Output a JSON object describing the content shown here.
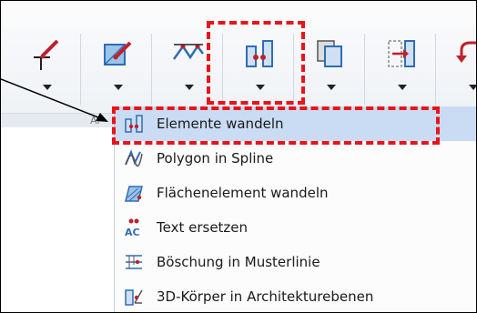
{
  "ribbon": {
    "group_label": "Är",
    "tools": [
      {
        "name": "line-pencil-tool",
        "icon": "pencil-line-icon"
      },
      {
        "name": "edit-surface-tool",
        "icon": "edit-surface-icon"
      },
      {
        "name": "polyline-tool",
        "icon": "polyline-icon"
      },
      {
        "name": "convert-elements-tool",
        "icon": "convert-elements-icon"
      },
      {
        "name": "copy-tool",
        "icon": "copy-icon"
      },
      {
        "name": "move-into-tool",
        "icon": "move-into-icon"
      },
      {
        "name": "undo-tool",
        "icon": "undo-icon"
      }
    ]
  },
  "menu": {
    "items": [
      {
        "label": "Elemente wandeln",
        "icon": "convert-elements-icon",
        "selected": true
      },
      {
        "label": "Polygon in Spline",
        "icon": "polygon-spline-icon",
        "selected": false
      },
      {
        "label": "Flächenelement wandeln",
        "icon": "surface-element-icon",
        "selected": false
      },
      {
        "label": "Text ersetzen",
        "icon": "text-replace-icon",
        "selected": false
      },
      {
        "label": "Böschung in Musterlinie",
        "icon": "slope-pattern-icon",
        "selected": false
      },
      {
        "label": "3D-Körper in Architekturebenen",
        "icon": "3d-body-icon",
        "selected": false
      }
    ]
  },
  "colors": {
    "highlight": "#e8141a",
    "selected_bg": "#c9dcf3",
    "accent_red": "#c0202a",
    "accent_blue": "#2f6db5"
  }
}
